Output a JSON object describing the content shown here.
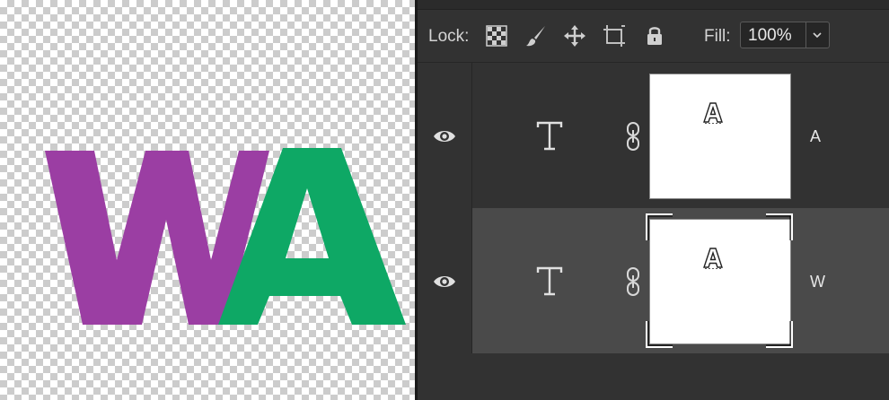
{
  "lock_bar": {
    "label": "Lock:",
    "icons": [
      "lock-transparent-pixels-icon",
      "lock-image-pixels-icon",
      "lock-position-icon",
      "lock-artboard-icon",
      "lock-all-icon"
    ],
    "fill_label": "Fill:",
    "fill_value": "100%"
  },
  "layers": [
    {
      "name": "A",
      "type": "text",
      "visible": true,
      "selected": false
    },
    {
      "name": "W",
      "type": "text",
      "visible": true,
      "selected": true
    }
  ],
  "canvas": {
    "letters": [
      {
        "char": "W",
        "color": "#9b3ea3"
      },
      {
        "char": "A",
        "color": "#0ea865"
      }
    ]
  },
  "colors": {
    "panel_bg": "#323232",
    "selected_row_bg": "#4a4a4a",
    "w_color": "#9b3ea3",
    "a_color": "#0ea865"
  }
}
